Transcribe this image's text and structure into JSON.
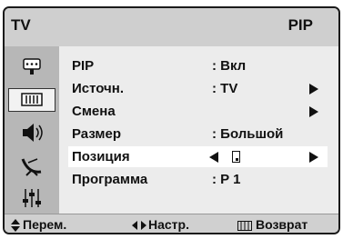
{
  "header": {
    "app_label": "TV",
    "menu_title": "PIP"
  },
  "sidebar": {
    "tabs": [
      {
        "icon": "input-plug-icon",
        "active": false
      },
      {
        "icon": "picture-icon",
        "active": true
      },
      {
        "icon": "speaker-icon",
        "active": false
      },
      {
        "icon": "satellite-dish-icon",
        "active": false
      },
      {
        "icon": "settings-sliders-icon",
        "active": false
      }
    ]
  },
  "menu": {
    "items": [
      {
        "label": "PIP",
        "value": ": Вкл",
        "has_submenu": false,
        "selected": false
      },
      {
        "label": "Источн.",
        "value": ": TV",
        "has_submenu": true,
        "selected": false
      },
      {
        "label": "Смена",
        "value": "",
        "has_submenu": true,
        "selected": false
      },
      {
        "label": "Размер",
        "value": ": Большой",
        "has_submenu": false,
        "selected": false
      },
      {
        "label": "Позиция",
        "value": "",
        "has_submenu": false,
        "selected": true,
        "control": "position-selector"
      },
      {
        "label": "Программа",
        "value": ": P 1",
        "has_submenu": false,
        "selected": false
      }
    ]
  },
  "footer": {
    "move_icon": "up-down-arrows-icon",
    "move_label": "Перем.",
    "adjust_icon": "left-right-arrows-icon",
    "adjust_label": "Настр.",
    "return_icon": "menu-icon",
    "return_label": "Возврат"
  },
  "colors": {
    "title_bar": "#cfcfcf",
    "sidebar": "#b7b7b7",
    "panel": "#ececec",
    "selected_row": "#ffffff",
    "text": "#111111"
  }
}
